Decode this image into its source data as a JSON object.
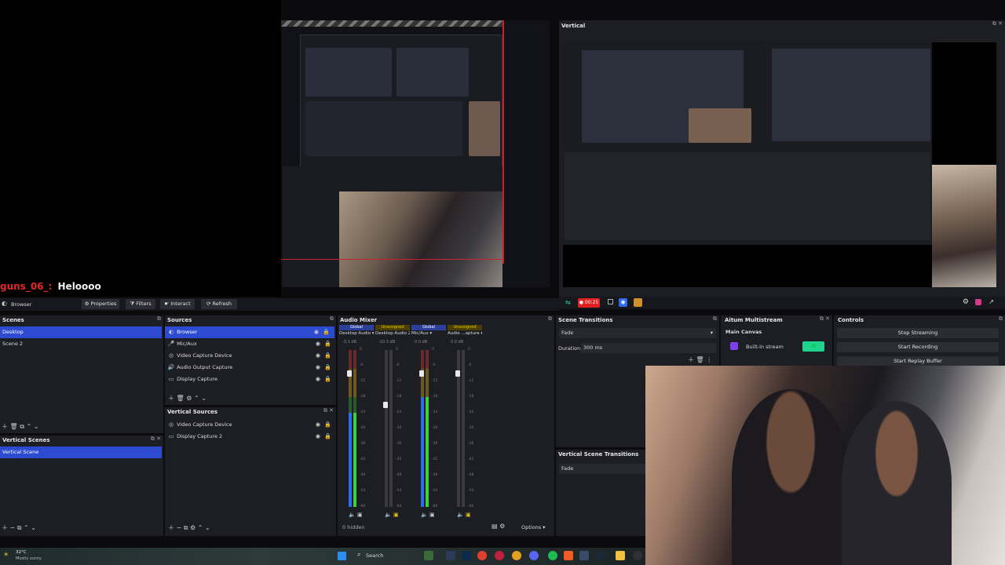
{
  "chat": {
    "user": "guns_06_:",
    "message": "Heloooo"
  },
  "vertical_preview": {
    "title": "Vertical"
  },
  "toolbar": {
    "browser_label": "Browser",
    "properties_label": "Properties",
    "filters_label": "Filters",
    "interact_label": "Interact",
    "refresh_label": "Refresh"
  },
  "vertical_controls": {
    "rec_time": "00:25"
  },
  "scenes": {
    "title": "Scenes",
    "items": [
      "Desktop",
      "Scene 2"
    ]
  },
  "vertical_scenes": {
    "title": "Vertical Scenes",
    "items": [
      "Vertical Scene"
    ]
  },
  "sources": {
    "title": "Sources",
    "items": [
      "Browser",
      "Mic/Aux",
      "Video Capture Device",
      "Audio Output Capture",
      "Display Capture"
    ]
  },
  "vertical_sources": {
    "title": "Vertical Sources",
    "items": [
      "Video Capture Device",
      "Display Capture 2"
    ]
  },
  "audio_mixer": {
    "title": "Audio Mixer",
    "channels": [
      {
        "tag": "Global",
        "name": "Desktop Audio",
        "db": "-3.1 dB",
        "level": 0.6,
        "tag_color": "#3a5bd9"
      },
      {
        "tag": "Unassigned",
        "name": "Desktop Audio 2",
        "db": "-10.3 dB",
        "level": 0.0,
        "tag_color": "#c8a800"
      },
      {
        "tag": "Global",
        "name": "Mic/Aux",
        "db": "0.0 dB",
        "level": 0.7,
        "tag_color": "#3a5bd9"
      },
      {
        "tag": "Unassigned",
        "name": "Audio ...apture",
        "db": "0.0 dB",
        "level": 0.0,
        "tag_color": "#c8a800"
      }
    ],
    "scale": [
      "0",
      "-6",
      "-12",
      "-18",
      "-24",
      "-30",
      "-36",
      "-42",
      "-48",
      "-54",
      "-60"
    ],
    "hidden": "0 hidden",
    "options_label": "Options"
  },
  "scene_transitions": {
    "title": "Scene Transitions",
    "transition": "Fade",
    "duration_label": "Duration",
    "duration_value": "300 ms"
  },
  "vertical_scene_transitions": {
    "title": "Vertical Scene Transitions",
    "transition": "Fade"
  },
  "multistream": {
    "title": "Aitum Multistream",
    "canvas": "Main Canvas",
    "stream": "Built-in stream"
  },
  "controls": {
    "title": "Controls",
    "buttons": [
      "Stop Streaming",
      "Start Recording",
      "Start Replay Buffer"
    ]
  },
  "taskbar": {
    "temp": "32°C",
    "weather": "Mostly sunny",
    "search": "Search"
  },
  "colors": {
    "accent": "#2c4bd1",
    "panel": "#1d1e24",
    "title_bar": "#17181d",
    "rec_red": "#e0201f",
    "stream_green": "#1fd38c"
  }
}
